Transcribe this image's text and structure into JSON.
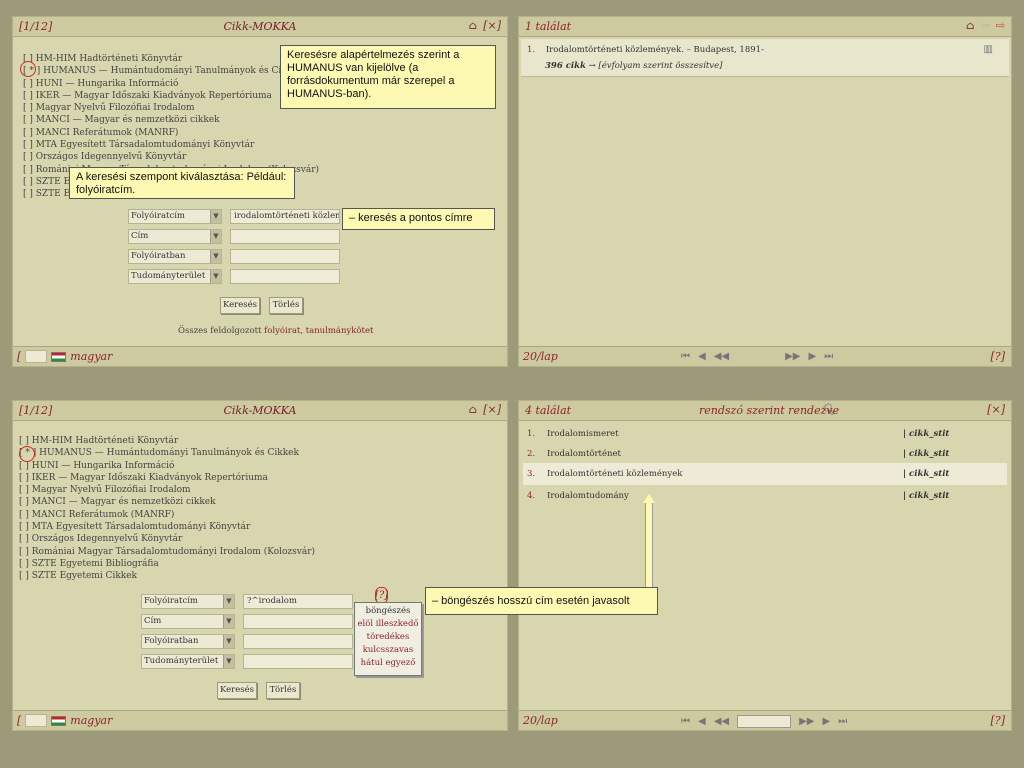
{
  "top": {
    "left": {
      "page": "[1/12]",
      "title": "Cikk-MOKKA",
      "close": "[×]",
      "libraries": [
        "[  ] HM-HIM Hadtörténeti Könyvtár",
        "[ * ] HUMANUS — Humántudományi Tanulmányok és Cikkek",
        "[  ] HUNI — Hungarika Információ",
        "[  ] IKER — Magyar Időszaki Kiadványok Repertóriuma",
        "[  ] Magyar Nyelvű Filozófiai Irodalom",
        "[  ] MANCI — Magyar és nemzetközi cikkek",
        "[  ] MANCI Referátumok (MANRF)",
        "[  ] MTA Egyesített Társadalomtudományi Könyvtár",
        "[  ] Országos Idegennyelvű Könyvtár",
        "[  ] Romániai Magyar Társadalomtudományi Irodalom (Kolozsvár)",
        "[  ] SZTE Egyetemi Bibliográfia",
        "[  ] SZTE Egyetemi Cikkek"
      ],
      "fields": [
        {
          "label": "Folyóiratcím",
          "value": "irodalomtörténeti közlemény"
        },
        {
          "label": "Cím",
          "value": ""
        },
        {
          "label": "Folyóiratban",
          "value": ""
        },
        {
          "label": "Tudományterület",
          "value": ""
        }
      ],
      "search": "Keresés",
      "clear": "Törlés",
      "summary": "Összes feldolgozott",
      "summary_link1": "folyóirat",
      "summary_sep": ",",
      "summary_link2": "tanulmánykötet",
      "lang_prefix": "[",
      "lang": "magyar"
    },
    "right": {
      "title": "1 találat",
      "result_num": "1.",
      "result_line1": "Irodalomtörténeti közlemények. – Budapest, 1891-",
      "result_count": "396 cikk",
      "result_line2": "→ [évfolyam szerint összesítve]",
      "perpage": "20/lap",
      "help": "[?]"
    },
    "callouts": {
      "default": "Keresésre alapértelmezés szerint a HUMANUS van kijelölve (a forrásdokumentum már szerepel a HUMANUS-ban).",
      "aspect": "A  keresési szempont kiválasztása: Például:  folyóiratcím.",
      "exact": "–  keresés a pontos címre"
    }
  },
  "bottom": {
    "left": {
      "page": "[1/12]",
      "title": "Cikk-MOKKA",
      "close": "[×]",
      "libraries": [
        "[  ] HM-HIM Hadtörténeti Könyvtár",
        "[ * ] HUMANUS — Humántudományi Tanulmányok és Cikkek",
        "[  ] HUNI — Hungarika Információ",
        "[  ] IKER — Magyar Időszaki Kiadványok Repertóriuma",
        "[  ] Magyar Nyelvű Filozófiai Irodalom",
        "[  ] MANCI — Magyar és nemzetközi cikkek",
        "[  ] MANCI Referátumok (MANRF)",
        "[  ] MTA Egyesített Társadalomtudományi Könyvtár",
        "[  ] Országos Idegennyelvű Könyvtár",
        "[  ] Romániai Magyar Társadalomtudományi Irodalom (Kolozsvár)",
        "[  ] SZTE Egyetemi Bibliográfia",
        "[  ] SZTE Egyetemi Cikkek"
      ],
      "fields": [
        {
          "label": "Folyóiratcím",
          "value": "?^irodalom"
        },
        {
          "label": "Cím",
          "value": ""
        },
        {
          "label": "Folyóiratban",
          "value": ""
        },
        {
          "label": "Tudományterület",
          "value": ""
        }
      ],
      "help_marker": "[?]",
      "popup": [
        "böngészés",
        "elöl illeszkedő",
        "töredékes",
        "kulcsszavas",
        "hátul egyező"
      ],
      "search": "Keresés",
      "clear": "Törlés",
      "lang_prefix": "[",
      "lang": "magyar"
    },
    "right": {
      "title": "4 találat",
      "sort": "rendszó szerint rendezve",
      "close": "[×]",
      "results": [
        {
          "num": "1.",
          "text": "Irodalomismeret",
          "tag": "| cikk_stit"
        },
        {
          "num": "2.",
          "text": "Irodalomtörténet",
          "tag": "| cikk_stit"
        },
        {
          "num": "3.",
          "text": "Irodalomtörténeti közlemények",
          "tag": "| cikk_stit"
        },
        {
          "num": "4.",
          "text": "Irodalomtudomány",
          "tag": "| cikk_stit"
        }
      ],
      "perpage": "20/lap",
      "help": "[?]"
    },
    "callouts": {
      "browse": "– böngészés hosszú cím esetén javasolt"
    }
  }
}
